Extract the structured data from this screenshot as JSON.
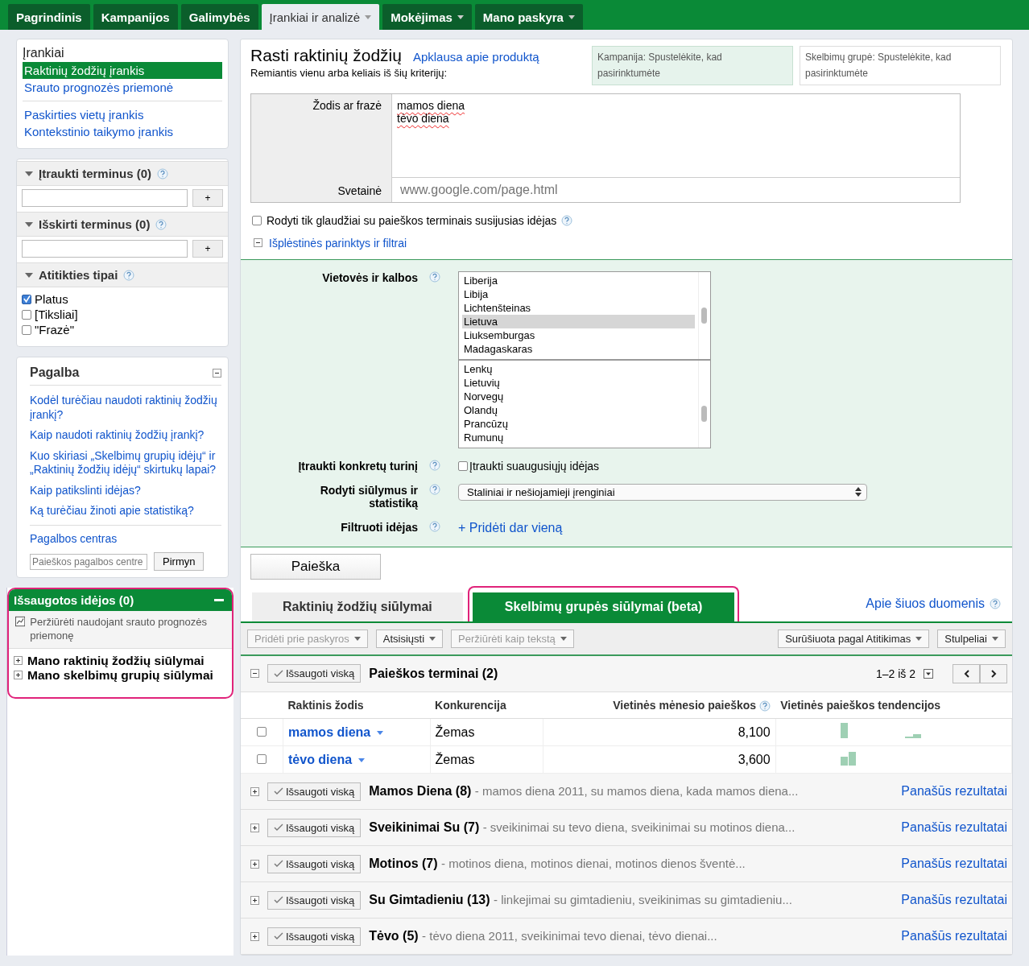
{
  "nav": {
    "tabs": [
      {
        "label": "Pagrindinis",
        "selected": false,
        "dropdown": false
      },
      {
        "label": "Kampanijos",
        "selected": false,
        "dropdown": false
      },
      {
        "label": "Galimybės",
        "selected": false,
        "dropdown": false
      },
      {
        "label": "Įrankiai ir analizė",
        "selected": true,
        "dropdown": true
      },
      {
        "label": "Mokėjimas",
        "selected": false,
        "dropdown": true
      },
      {
        "label": "Mano paskyra",
        "selected": false,
        "dropdown": true
      }
    ]
  },
  "sidebar": {
    "tools": {
      "title": "Įrankiai",
      "groups": [
        [
          {
            "label": "Raktinių žodžių įrankis",
            "selected": true
          },
          {
            "label": "Srauto prognozės priemonė",
            "selected": false
          }
        ],
        [
          {
            "label": "Paskirties vietų įrankis",
            "selected": false
          },
          {
            "label": "Kontekstinio taikymo įrankis",
            "selected": false
          }
        ]
      ]
    },
    "include_terms": {
      "title": "Įtraukti terminus (0)",
      "add_button": "+"
    },
    "exclude_terms": {
      "title": "Išskirti terminus (0)",
      "add_button": "+"
    },
    "match_types": {
      "title": "Atitikties tipai",
      "options": [
        {
          "label": "Platus",
          "checked": true
        },
        {
          "label": "[Tiksliai]",
          "checked": false
        },
        {
          "label": "\"Frazė\"",
          "checked": false
        }
      ]
    },
    "help": {
      "title": "Pagalba",
      "links": [
        "Kodėl turėčiau naudoti raktinių žodžių įrankį?",
        "Kaip naudoti raktinių žodžių įrankį?",
        "Kuo skiriasi „Skelbimų grupių idėjų“ ir „Raktinių žodžių idėjų“ skirtukų lapai?",
        "Kaip patikslinti idėjas?",
        "Ką turėčiau žinoti apie statistiką?"
      ],
      "center_link": "Pagalbos centras",
      "search_placeholder": "Paieškos pagalbos centre",
      "go_button": "Pirmyn"
    },
    "saved": {
      "title": "Išsaugotos idėjos (0)",
      "forecast_link": "Peržiūrėti naudojant srauto prognozės priemonę",
      "items": [
        "Mano raktinių žodžių siūlymai",
        "Mano skelbimų grupių siūlymai"
      ]
    }
  },
  "main": {
    "title": "Rasti raktinių žodžių",
    "survey_link": "Apklausa apie produktą",
    "subtitle": "Remiantis vienu arba keliais iš šių kriterijų:",
    "campaign_picker": "Kampanija: Spustelėkite, kad pasirinktumėte",
    "adgroup_picker": "Skelbimų grupė: Spustelėkite, kad pasirinktumėte",
    "word_label": "Žodis ar frazė",
    "words": [
      "mamos diena",
      "tėvo diena"
    ],
    "site_label": "Svetainė",
    "site_placeholder": "www.google.com/page.html",
    "closely_related": {
      "label": "Rodyti tik glaudžiai su paieškos terminais susijusias idėjas",
      "checked": false
    },
    "advanced_toggle": {
      "label": "Išplėstinės parinktys ir filtrai",
      "expanded": true
    },
    "filters": {
      "locations_label": "Vietovės ir kalbos",
      "countries": [
        {
          "label": "Liberija",
          "selected": false
        },
        {
          "label": "Libija",
          "selected": false
        },
        {
          "label": "Lichtenšteinas",
          "selected": false
        },
        {
          "label": "Lietuva",
          "selected": true
        },
        {
          "label": "Liuksemburgas",
          "selected": false
        },
        {
          "label": "Madagaskaras",
          "selected": false
        }
      ],
      "languages": [
        {
          "label": "Lenkų",
          "selected": false
        },
        {
          "label": "Lietuvių",
          "selected": false
        },
        {
          "label": "Norvegų",
          "selected": false
        },
        {
          "label": "Olandų",
          "selected": false
        },
        {
          "label": "Prancūzų",
          "selected": false
        },
        {
          "label": "Rumunų",
          "selected": false
        }
      ],
      "content_label": "Įtraukti konkretų turinį",
      "adult": {
        "label": "Įtraukti suaugusiųjų idėjas",
        "checked": false
      },
      "device_label": "Rodyti siūlymus ir statistiką",
      "device_value": "Staliniai ir nešiojamieji įrenginiai",
      "filter_label": "Filtruoti idėjas",
      "add_filter": "+ Pridėti dar vieną"
    },
    "search_button": "Paieška",
    "result_tabs": [
      {
        "label": "Raktinių žodžių siūlymai",
        "selected": false
      },
      {
        "label": "Skelbimų grupės siūlymai (beta)",
        "selected": true
      }
    ],
    "about_link": "Apie šiuos duomenis",
    "toolbar": {
      "actions": [
        {
          "label": "Pridėti prie paskyros",
          "disabled": true
        },
        {
          "label": "Atsisiųsti",
          "disabled": false
        },
        {
          "label": "Peržiūrėti kaip tekstą",
          "disabled": true
        }
      ],
      "view": [
        {
          "label": "Surūšiuota pagal Atitikimas",
          "disabled": false
        },
        {
          "label": "Stulpeliai",
          "disabled": false
        }
      ]
    },
    "search_terms": {
      "save_button": "Išsaugoti viską",
      "title": "Paieškos terminai (2)",
      "pager": "1–2 iš 2",
      "expanded": true,
      "columns": [
        "Raktinis žodis",
        "Konkurencija",
        "Vietinės mėnesio paieškos",
        "Vietinės paieškos tendencijos"
      ],
      "rows": [
        {
          "keyword": "mamos diena",
          "competition": "Žemas",
          "searches": "8,100",
          "checked": false
        },
        {
          "keyword": "tėvo diena",
          "competition": "Žemas",
          "searches": "3,600",
          "checked": false
        }
      ]
    },
    "groups": [
      {
        "title": "Mamos Diena (8)",
        "terms": "- mamos diena 2011, su mamos diena, kada mamos diena...",
        "save_button": "Išsaugoti viską",
        "similar_link": "Panašūs rezultatai",
        "expanded": false
      },
      {
        "title": "Sveikinimai Su (7)",
        "terms": "- sveikinimai su tevo diena, sveikinimai su motinos diena...",
        "save_button": "Išsaugoti viską",
        "similar_link": "Panašūs rezultatai",
        "expanded": false
      },
      {
        "title": "Motinos (7)",
        "terms": "- motinos diena, motinos dienai, motinos dienos šventė...",
        "save_button": "Išsaugoti viską",
        "similar_link": "Panašūs rezultatai",
        "expanded": false
      },
      {
        "title": "Su Gimtadieniu (13)",
        "terms": "- linkejimai su gimtadieniu, sveikinimas su gimtadieniu...",
        "save_button": "Išsaugoti viską",
        "similar_link": "Panašūs rezultatai",
        "expanded": false
      },
      {
        "title": "Tėvo (5)",
        "terms": "- tėvo diena 2011, sveikinimai tevo dienai, tėvo dienai...",
        "save_button": "Išsaugoti viską",
        "similar_link": "Panašūs rezultatai",
        "expanded": false
      }
    ]
  }
}
